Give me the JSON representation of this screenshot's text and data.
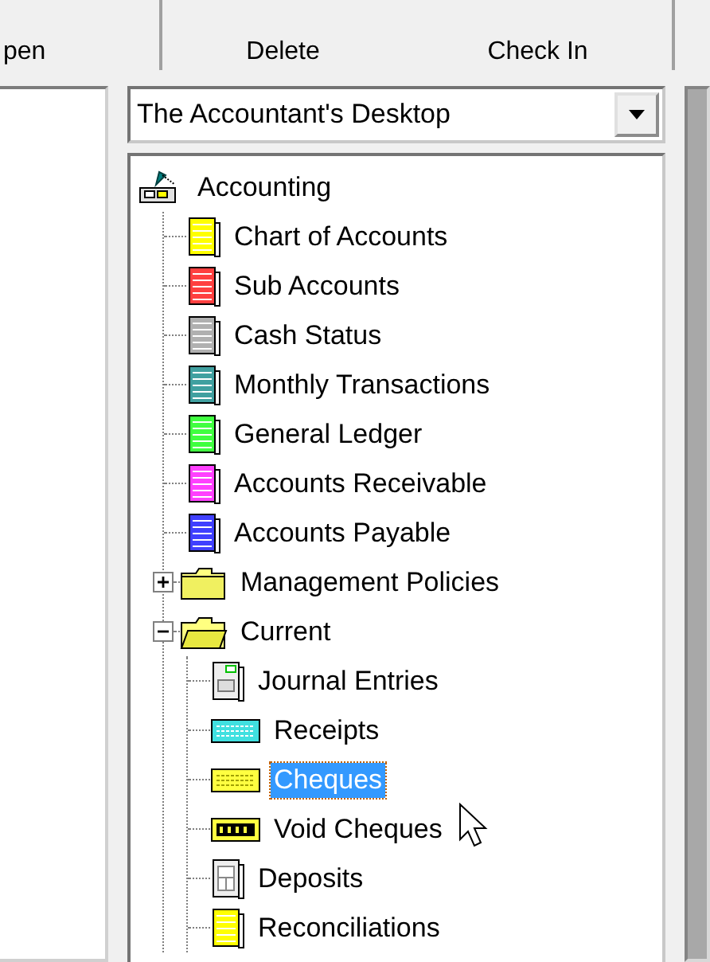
{
  "toolbar": {
    "buttons": [
      {
        "label": "pen"
      },
      {
        "label": "Delete"
      },
      {
        "label": "Check In"
      }
    ]
  },
  "desktop_select": {
    "value": "The Accountant's Desktop"
  },
  "tree": {
    "label": "Accounting",
    "kind": "root",
    "selected": false,
    "children": [
      {
        "label": "Chart of Accounts",
        "kind": "book",
        "color": "#ffff00",
        "selected": false
      },
      {
        "label": "Sub Accounts",
        "kind": "book",
        "color": "#ff4040",
        "selected": false
      },
      {
        "label": "Cash Status",
        "kind": "book",
        "color": "#b0b0b0",
        "selected": false
      },
      {
        "label": "Monthly Transactions",
        "kind": "book",
        "color": "#40a0a0",
        "selected": false
      },
      {
        "label": "General Ledger",
        "kind": "book",
        "color": "#40ff40",
        "selected": false
      },
      {
        "label": "Accounts Receivable",
        "kind": "book",
        "color": "#ff40ff",
        "selected": false
      },
      {
        "label": "Accounts Payable",
        "kind": "book",
        "color": "#4040ff",
        "selected": false
      },
      {
        "label": "Management Policies",
        "kind": "folder",
        "selected": false,
        "expanded": false
      },
      {
        "label": "Current",
        "kind": "folder",
        "selected": false,
        "expanded": true,
        "children": [
          {
            "label": "Journal Entries",
            "kind": "journal",
            "selected": false
          },
          {
            "label": "Receipts",
            "kind": "receipts",
            "selected": false
          },
          {
            "label": "Cheques",
            "kind": "cheque",
            "selected": true
          },
          {
            "label": "Void Cheques",
            "kind": "void",
            "selected": false
          },
          {
            "label": "Deposits",
            "kind": "deposit",
            "selected": false
          },
          {
            "label": "Reconciliations",
            "kind": "book",
            "color": "#ffff00",
            "selected": false
          }
        ]
      }
    ]
  }
}
